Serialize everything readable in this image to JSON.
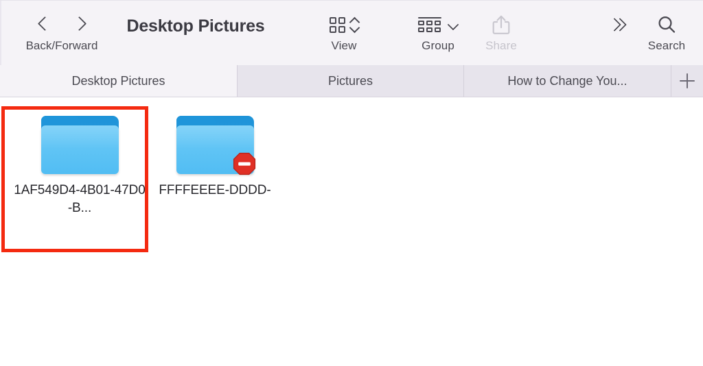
{
  "window": {
    "title": "Desktop Pictures"
  },
  "toolbar": {
    "nav": {
      "back_icon": "chevron-left-icon",
      "forward_icon": "chevron-right-icon",
      "label": "Back/Forward"
    },
    "view": {
      "icon": "grid-view-icon",
      "chevron_icon": "chevron-up-down-icon",
      "label": "View"
    },
    "group": {
      "icon": "group-list-icon",
      "chevron_icon": "chevron-down-icon",
      "label": "Group"
    },
    "share": {
      "icon": "share-icon",
      "label": "Share",
      "disabled": true
    },
    "overflow": {
      "icon": "double-chevron-right-icon",
      "label": ""
    },
    "search": {
      "icon": "search-icon",
      "label": "Search"
    }
  },
  "tabs": {
    "items": [
      {
        "label": "Desktop Pictures",
        "active": true
      },
      {
        "label": "Pictures",
        "active": false
      },
      {
        "label": "How to Change You...",
        "active": false
      }
    ],
    "new_tab_icon": "plus-icon"
  },
  "content": {
    "items": [
      {
        "name": "1AF549D4-4B01-47D0-B...",
        "icon": "folder-icon",
        "badge": "",
        "selected": false
      },
      {
        "name": "FFFFEEEE-DDDD-",
        "icon": "folder-icon",
        "badge": "no-access-badge-icon",
        "selected": false
      }
    ]
  },
  "annotation": {
    "shape": "rectangle",
    "color": "#f42a10",
    "targets": "1AF549D4-4B01-47D0-B..."
  },
  "colors": {
    "toolbar_bg": "#f5f3f7",
    "tabbar_bg": "#e7e4ec",
    "active_tab_bg": "#f5f3f7",
    "content_bg": "#ffffff",
    "folder_front": "#51bdf3",
    "folder_back": "#1f95da",
    "badge_red": "#e03025",
    "annotation_red": "#f42a10",
    "text": "#3b3a42",
    "disabled_text": "#c6c4cc"
  }
}
